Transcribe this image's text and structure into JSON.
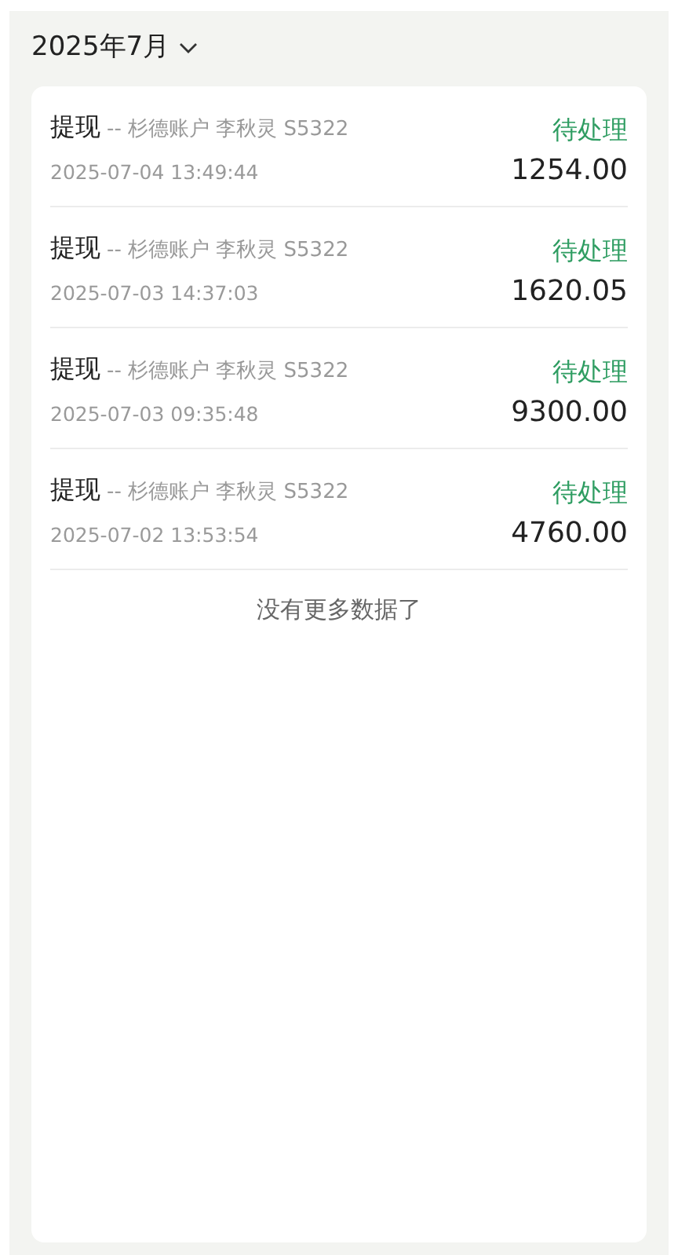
{
  "month_picker": {
    "label": "2025年7月",
    "expanded": false
  },
  "records": [
    {
      "type": "提现",
      "detail": "-- 杉德账户 李秋灵 S5322",
      "time": "2025-07-04 13:49:44",
      "status": "待处理",
      "amount": "1254.00"
    },
    {
      "type": "提现",
      "detail": "-- 杉德账户 李秋灵 S5322",
      "time": "2025-07-03 14:37:03",
      "status": "待处理",
      "amount": "1620.05"
    },
    {
      "type": "提现",
      "detail": "-- 杉德账户 李秋灵 S5322",
      "time": "2025-07-03 09:35:48",
      "status": "待处理",
      "amount": "9300.00"
    },
    {
      "type": "提现",
      "detail": "-- 杉德账户 李秋灵 S5322",
      "time": "2025-07-02 13:53:54",
      "status": "待处理",
      "amount": "4760.00"
    }
  ],
  "end_note": "没有更多数据了"
}
